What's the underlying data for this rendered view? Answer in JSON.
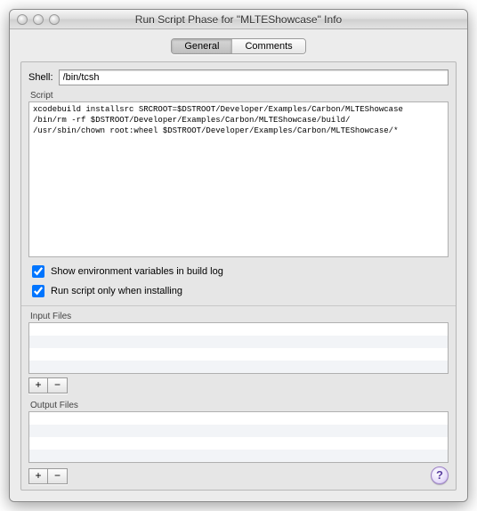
{
  "window": {
    "title": "Run Script Phase for \"MLTEShowcase\" Info"
  },
  "tabs": {
    "general": "General",
    "comments": "Comments",
    "active": "general"
  },
  "shell": {
    "label": "Shell:",
    "value": "/bin/tcsh"
  },
  "script": {
    "label": "Script",
    "value": "xcodebuild installsrc SRCROOT=$DSTROOT/Developer/Examples/Carbon/MLTEShowcase\n/bin/rm -rf $DSTROOT/Developer/Examples/Carbon/MLTEShowcase/build/\n/usr/sbin/chown root:wheel $DSTROOT/Developer/Examples/Carbon/MLTEShowcase/*"
  },
  "checks": {
    "show_env": "Show environment variables in build log",
    "run_only_install": "Run script only when installing"
  },
  "inputFiles": {
    "label": "Input Files"
  },
  "outputFiles": {
    "label": "Output Files"
  },
  "buttons": {
    "add": "+",
    "remove": "−",
    "help": "?"
  }
}
